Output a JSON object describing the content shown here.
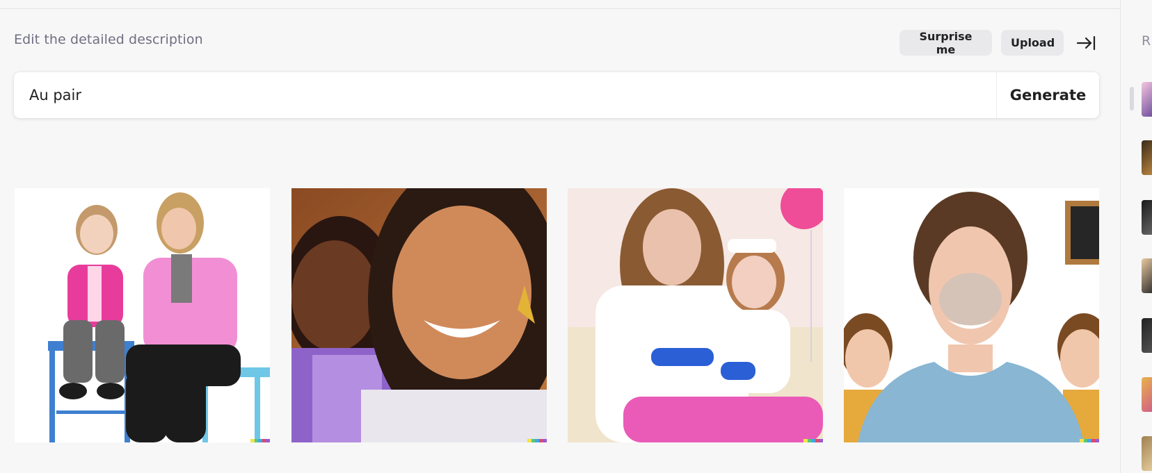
{
  "header": {
    "title": "Edit the detailed description",
    "surprise_label": "Surprise me",
    "upload_label": "Upload",
    "collapse_icon": "arrow-to-right-icon"
  },
  "prompt": {
    "value": "Au pair",
    "generate_label": "Generate"
  },
  "results": {
    "images": [
      {
        "description": "Young girl in pink cardigan and older woman in pink shirt sitting on blue stools"
      },
      {
        "description": "Smiling woman with earrings and young girl in purple top"
      },
      {
        "description": "Curly-haired woman holding toddler with headband and balloons"
      },
      {
        "description": "Woman with short hair and face paint with two boys and chalkboard"
      }
    ],
    "signature_colors": [
      "#f2e34b",
      "#59c779",
      "#44a5e6",
      "#e0496a",
      "#9b59d0"
    ]
  },
  "sidebar": {
    "label": "R",
    "thumbnail_count": 7
  },
  "colors": {
    "background": "#f7f7f8",
    "pill": "#e9e9ec",
    "text": "#202123",
    "muted": "#6e6e80"
  }
}
